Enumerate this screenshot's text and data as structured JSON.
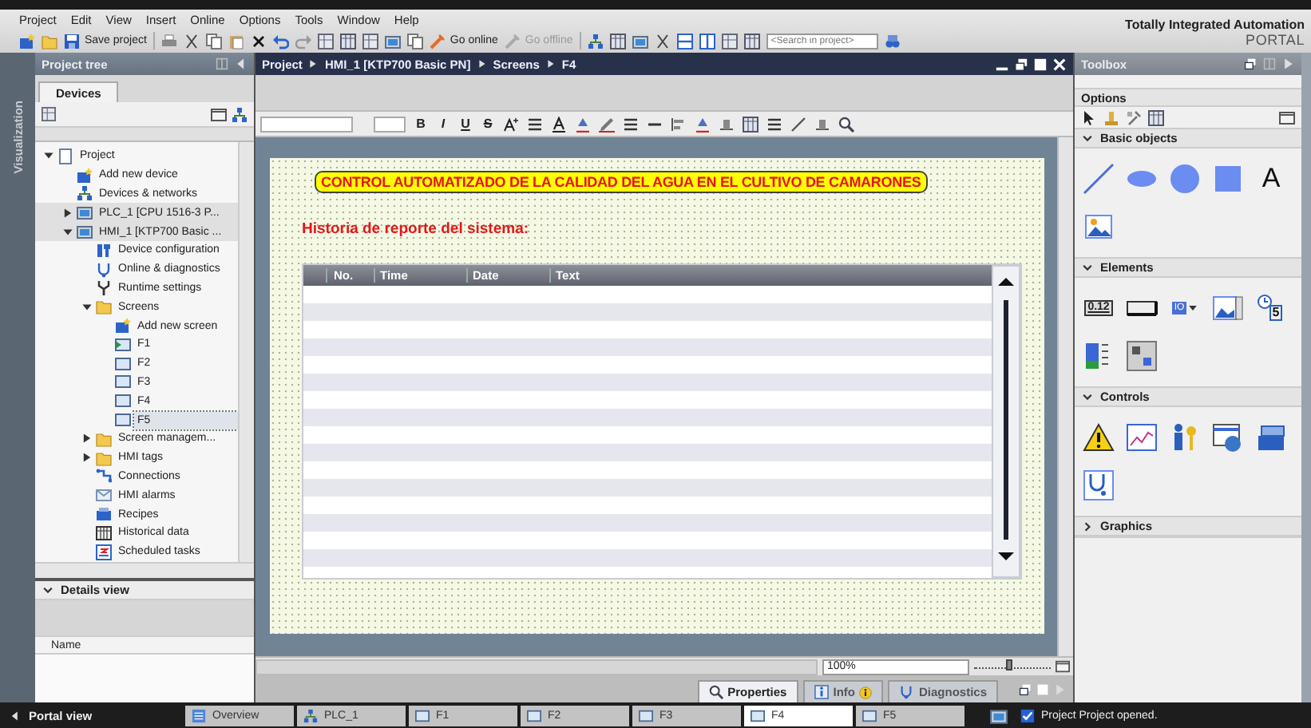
{
  "menu": [
    "Project",
    "Edit",
    "View",
    "Insert",
    "Online",
    "Options",
    "Tools",
    "Window",
    "Help"
  ],
  "toolbar": {
    "save": "Save project",
    "go_online": {
      "label": "Go online",
      "disabled": false
    },
    "go_offline": {
      "label": "Go offline",
      "disabled": true
    },
    "search": {
      "placeholder": "<Search in project>"
    }
  },
  "brand": {
    "title": "Totally Integrated Automation",
    "subtitle": "PORTAL"
  },
  "side_tab": "Visualization",
  "project_tree": {
    "title": "Project tree",
    "tabs": [
      {
        "label": "Devices",
        "selected": true
      }
    ],
    "items": [
      {
        "label": "Project",
        "kind": "project",
        "expanded": true,
        "selected": false,
        "children": [
          {
            "label": "Add new device",
            "kind": "add",
            "selected": false
          },
          {
            "label": "Devices & networks",
            "kind": "network",
            "selected": false
          },
          {
            "label": "PLC_1 [CPU 1516-3 P...",
            "kind": "device",
            "expanded": false,
            "selected": false
          },
          {
            "label": "HMI_1 [KTP700 Basic ...",
            "kind": "device",
            "expanded": true,
            "selected": false,
            "children": [
              {
                "label": "Device configuration",
                "kind": "config",
                "selected": false
              },
              {
                "label": "Online & diagnostics",
                "kind": "diagnostics",
                "selected": false
              },
              {
                "label": "Runtime settings",
                "kind": "runtime",
                "selected": false
              },
              {
                "label": "Screens",
                "kind": "folder",
                "expanded": true,
                "selected": false,
                "children": [
                  {
                    "label": "Add new screen",
                    "kind": "add",
                    "selected": false
                  },
                  {
                    "label": "F1",
                    "kind": "start-screen",
                    "selected": false
                  },
                  {
                    "label": "F2",
                    "kind": "screen",
                    "selected": false
                  },
                  {
                    "label": "F3",
                    "kind": "screen",
                    "selected": false
                  },
                  {
                    "label": "F4",
                    "kind": "screen",
                    "selected": false
                  },
                  {
                    "label": "F5",
                    "kind": "screen",
                    "selected": true
                  }
                ]
              },
              {
                "label": "Screen managem...",
                "kind": "folder",
                "expanded": false,
                "selected": false
              },
              {
                "label": "HMI tags",
                "kind": "folder",
                "expanded": false,
                "selected": false
              },
              {
                "label": "Connections",
                "kind": "connections",
                "selected": false
              },
              {
                "label": "HMI alarms",
                "kind": "alarms",
                "selected": false
              },
              {
                "label": "Recipes",
                "kind": "recipes",
                "selected": false
              },
              {
                "label": "Historical data",
                "kind": "history",
                "selected": false
              },
              {
                "label": "Scheduled tasks",
                "kind": "tasks",
                "selected": false
              }
            ]
          }
        ]
      }
    ],
    "details": {
      "title": "Details view",
      "expanded": true,
      "column": "Name"
    }
  },
  "editor": {
    "breadcrumb": [
      "Project",
      "HMI_1 [KTP700 Basic PN]",
      "Screens",
      "F4"
    ],
    "format_buttons": [
      "B",
      "I",
      "U",
      "S"
    ],
    "screen": {
      "title": "CONTROL AUTOMATIZADO DE LA CALIDAD DEL AGUA EN EL CULTIVO DE CAMARONES",
      "subtitle": "Historia de reporte del sistema:",
      "alarm_view": {
        "columns": [
          "No.",
          "Time",
          "Date",
          "Text"
        ]
      }
    },
    "zoom": {
      "value": "100%",
      "level": 0.45
    }
  },
  "inspector_tabs": [
    {
      "label": "Properties",
      "kind": "properties",
      "selected": true
    },
    {
      "label": "Info",
      "kind": "info",
      "selected": false
    },
    {
      "label": "Diagnostics",
      "kind": "diagnostics",
      "selected": false
    }
  ],
  "toolbox": {
    "title": "Toolbox",
    "options": "Options",
    "sections": [
      {
        "title": "Basic objects",
        "expanded": true,
        "items": [
          {
            "kind": "line"
          },
          {
            "kind": "ellipse"
          },
          {
            "kind": "circle"
          },
          {
            "kind": "rectangle"
          },
          {
            "kind": "text",
            "glyph": "A"
          },
          {
            "kind": "graphic"
          }
        ]
      },
      {
        "title": "Elements",
        "expanded": true,
        "items": [
          {
            "kind": "io-field",
            "glyph": "0.12"
          },
          {
            "kind": "button"
          },
          {
            "kind": "symbolic",
            "glyph": "IO"
          },
          {
            "kind": "graphic-io"
          },
          {
            "kind": "clock",
            "glyph": "5"
          },
          {
            "kind": "bar"
          },
          {
            "kind": "switch"
          }
        ]
      },
      {
        "title": "Controls",
        "expanded": true,
        "items": [
          {
            "kind": "alarm"
          },
          {
            "kind": "trend"
          },
          {
            "kind": "user"
          },
          {
            "kind": "browser"
          },
          {
            "kind": "recipe"
          },
          {
            "kind": "diagnostics"
          }
        ]
      },
      {
        "title": "Graphics",
        "expanded": false
      }
    ]
  },
  "taskbar": {
    "portal": "Portal view",
    "tabs": [
      {
        "label": "Overview",
        "kind": "overview",
        "selected": false
      },
      {
        "label": "PLC_1",
        "kind": "network",
        "selected": false
      },
      {
        "label": "F1",
        "kind": "screen",
        "selected": false
      },
      {
        "label": "F2",
        "kind": "screen",
        "selected": false
      },
      {
        "label": "F3",
        "kind": "screen",
        "selected": false
      },
      {
        "label": "F4",
        "kind": "screen",
        "selected": true
      },
      {
        "label": "F5",
        "kind": "screen",
        "selected": false
      }
    ],
    "status": "Project Project opened."
  }
}
